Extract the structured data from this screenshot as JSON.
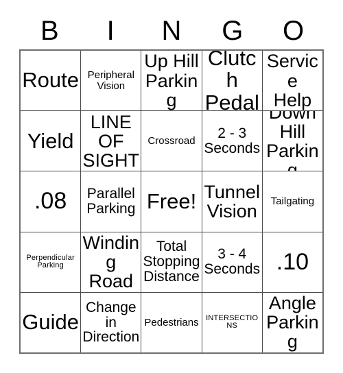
{
  "card": {
    "title_letters": [
      "B",
      "I",
      "N",
      "G",
      "O"
    ],
    "free_space_label": "Free!",
    "rows": [
      [
        {
          "text": "Route",
          "size": "s-xl"
        },
        {
          "text": "Peripheral\nVision",
          "size": "s-sm"
        },
        {
          "text": "Up Hill\nParking",
          "size": "s-lg"
        },
        {
          "text": "Clutch\nPedal",
          "size": "s-xl"
        },
        {
          "text": "Service\nHelp",
          "size": "s-lg"
        }
      ],
      [
        {
          "text": "Yield",
          "size": "s-xl"
        },
        {
          "text": "LINE\nOF\nSIGHT",
          "size": "s-lg"
        },
        {
          "text": "Crossroad",
          "size": "s-sm"
        },
        {
          "text": "2 - 3\nSeconds",
          "size": "s-md"
        },
        {
          "text": "Down\nHill\nParking",
          "size": "s-lg"
        }
      ],
      [
        {
          "text": ".08",
          "size": "s-num"
        },
        {
          "text": "Parallel\nParking",
          "size": "s-md"
        },
        {
          "text": "Free!",
          "size": "s-xl"
        },
        {
          "text": "Tunnel\nVision",
          "size": "s-lg"
        },
        {
          "text": "Tailgating",
          "size": "s-sm"
        }
      ],
      [
        {
          "text": "Perpendicular\nParking",
          "size": "s-xs"
        },
        {
          "text": "Winding\nRoad",
          "size": "s-lg"
        },
        {
          "text": "Total\nStopping\nDistance",
          "size": "s-md"
        },
        {
          "text": "3 - 4\nSeconds",
          "size": "s-md"
        },
        {
          "text": ".10",
          "size": "s-num"
        }
      ],
      [
        {
          "text": "Guide",
          "size": "s-xl"
        },
        {
          "text": "Change\nin\nDirection",
          "size": "s-md"
        },
        {
          "text": "Pedestrians",
          "size": "s-sm"
        },
        {
          "text": "INTERSECTIONS",
          "size": "s-xs"
        },
        {
          "text": "Angle\nParking",
          "size": "s-lg"
        }
      ]
    ]
  },
  "colors": {
    "background": "#ffffff",
    "text": "#000000",
    "grid_line": "#4a4a4a",
    "outer_border": "#6e6e6e"
  }
}
